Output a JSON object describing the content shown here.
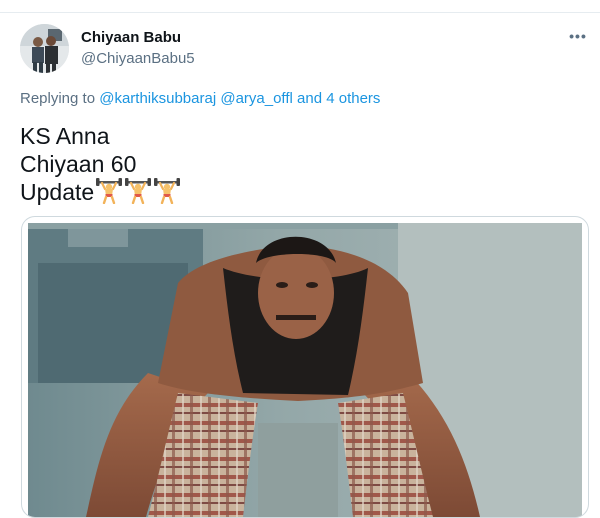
{
  "tweet": {
    "author_name": "Chiyaan Babu",
    "author_handle": "@ChiyaanBabu5",
    "more_label": "•••",
    "reply": {
      "prefix": "Replying to",
      "mentions": [
        "@karthiksubbaraj",
        "@arya_offl"
      ],
      "conjunction": "and",
      "others": "4 others"
    },
    "text_lines": [
      "KS Anna",
      "Chiyaan 60",
      "Update"
    ],
    "emoji_name": "person-lifting-weights-emoji",
    "emoji_count": 3,
    "media_subject": "shirtless man in vest and checked lungi bent forward",
    "colors": {
      "link": "#1b95e0",
      "secondary_text": "#5b7083",
      "primary_text": "#0f1419",
      "border": "#cfd9de"
    }
  }
}
